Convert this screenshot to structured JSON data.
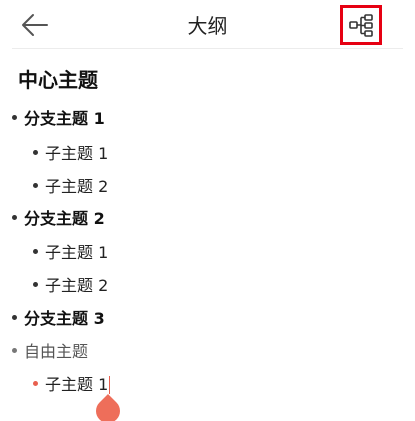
{
  "header": {
    "title": "大纲",
    "back_icon": "arrow-left-icon",
    "structure_icon": "mindmap-structure-icon",
    "highlight_color": "#e60012"
  },
  "outline": {
    "central_topic": "中心主题",
    "nodes": [
      {
        "label": "分支主题 1",
        "level": "branch"
      },
      {
        "label": "子主题 1",
        "level": "sub"
      },
      {
        "label": "子主题 2",
        "level": "sub"
      },
      {
        "label": "分支主题 2",
        "level": "branch"
      },
      {
        "label": "子主题 1",
        "level": "sub"
      },
      {
        "label": "子主题 2",
        "level": "sub"
      },
      {
        "label": "分支主题 3",
        "level": "branch"
      },
      {
        "label": "自由主题",
        "level": "free"
      },
      {
        "label": "子主题 1",
        "level": "sub",
        "editing": true
      }
    ]
  },
  "colors": {
    "accent": "#e8604f"
  }
}
